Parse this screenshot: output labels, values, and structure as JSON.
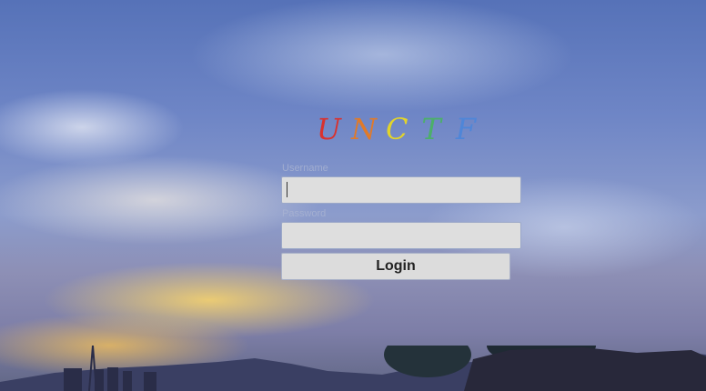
{
  "logo": {
    "letters": [
      {
        "char": "U",
        "color": "#d9322e"
      },
      {
        "char": "N",
        "color": "#e07a2a"
      },
      {
        "char": "C",
        "color": "#e2d42a"
      },
      {
        "char": "T",
        "color": "#4caf6a"
      },
      {
        "char": "F",
        "color": "#4f86d8"
      }
    ]
  },
  "form": {
    "username_label": "Username",
    "username_value": "",
    "password_label": "Password",
    "password_value": "",
    "login_label": "Login"
  },
  "colors": {
    "input_bg": "#dedede",
    "button_bg": "#dcdcdc"
  }
}
